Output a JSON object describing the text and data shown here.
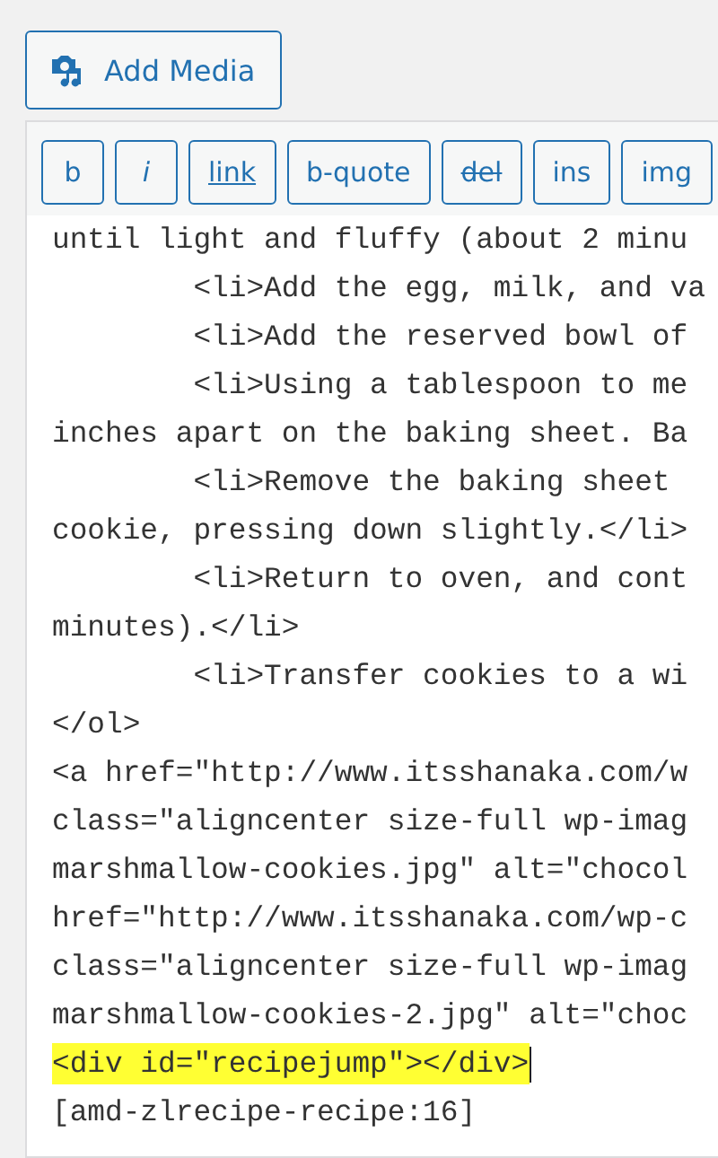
{
  "add_media_button": {
    "label": "Add Media"
  },
  "toolbar": [
    {
      "label": "b",
      "kind": "plain"
    },
    {
      "label": "i",
      "kind": "italic"
    },
    {
      "label": "link",
      "kind": "underline"
    },
    {
      "label": "b-quote",
      "kind": "plain"
    },
    {
      "label": "del",
      "kind": "strike"
    },
    {
      "label": "ins",
      "kind": "plain"
    },
    {
      "label": "img",
      "kind": "plain"
    }
  ],
  "code_lines": [
    {
      "text": "until light and fluffy (about 2 minu",
      "highlighted": false
    },
    {
      "text": "        <li>Add the egg, milk, and va",
      "highlighted": false
    },
    {
      "text": "        <li>Add the reserved bowl of",
      "highlighted": false
    },
    {
      "text": "        <li>Using a tablespoon to me",
      "highlighted": false
    },
    {
      "text": "inches apart on the baking sheet. Ba",
      "highlighted": false
    },
    {
      "text": "        <li>Remove the baking sheet",
      "highlighted": false
    },
    {
      "text": "cookie, pressing down slightly.</li>",
      "highlighted": false
    },
    {
      "text": "        <li>Return to oven, and cont",
      "highlighted": false
    },
    {
      "text": "minutes).</li>",
      "highlighted": false
    },
    {
      "text": "        <li>Transfer cookies to a wi",
      "highlighted": false
    },
    {
      "text": "</ol>",
      "highlighted": false
    },
    {
      "text": "<a href=\"http://www.itsshanaka.com/w",
      "highlighted": false
    },
    {
      "text": "class=\"aligncenter size-full wp-imag",
      "highlighted": false
    },
    {
      "text": "marshmallow-cookies.jpg\" alt=\"chocol",
      "highlighted": false
    },
    {
      "text": "href=\"http://www.itsshanaka.com/wp-c",
      "highlighted": false
    },
    {
      "text": "class=\"aligncenter size-full wp-imag",
      "highlighted": false
    },
    {
      "text": "marshmallow-cookies-2.jpg\" alt=\"choc",
      "highlighted": false
    },
    {
      "text": "<div id=\"recipejump\"></div>",
      "highlighted": true
    },
    {
      "text": "[amd-zlrecipe-recipe:16]",
      "highlighted": false
    }
  ]
}
